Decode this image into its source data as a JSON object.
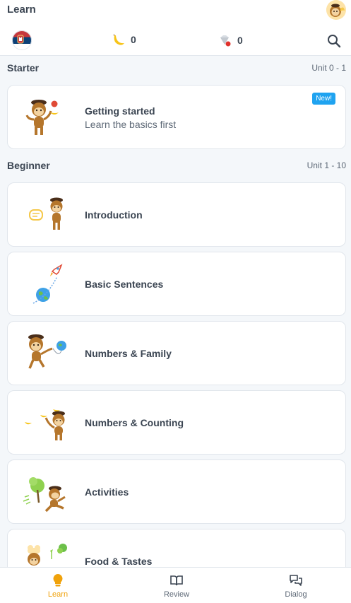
{
  "header": {
    "title": "Learn",
    "avatar_icon": "monkey-avatar-icon",
    "flag_icon": "serbia-flag-icon",
    "bananas_count": "0",
    "gems_count": "0"
  },
  "sections": [
    {
      "title": "Starter",
      "range": "Unit 0 - 1",
      "lessons": [
        {
          "title": "Getting started",
          "subtitle": "Learn the basics first",
          "badge": "New!"
        }
      ]
    },
    {
      "title": "Beginner",
      "range": "Unit 1 - 10",
      "lessons": [
        {
          "title": "Introduction"
        },
        {
          "title": "Basic Sentences"
        },
        {
          "title": "Numbers & Family"
        },
        {
          "title": "Numbers & Counting"
        },
        {
          "title": "Activities"
        },
        {
          "title": "Food & Tastes"
        }
      ]
    }
  ],
  "bottom_nav": {
    "learn": "Learn",
    "review": "Review",
    "dialog": "Dialog"
  },
  "colors": {
    "accent": "#f0a20b",
    "badge": "#1fa3f0",
    "text": "#3b4552",
    "background": "#f4f7fa"
  }
}
